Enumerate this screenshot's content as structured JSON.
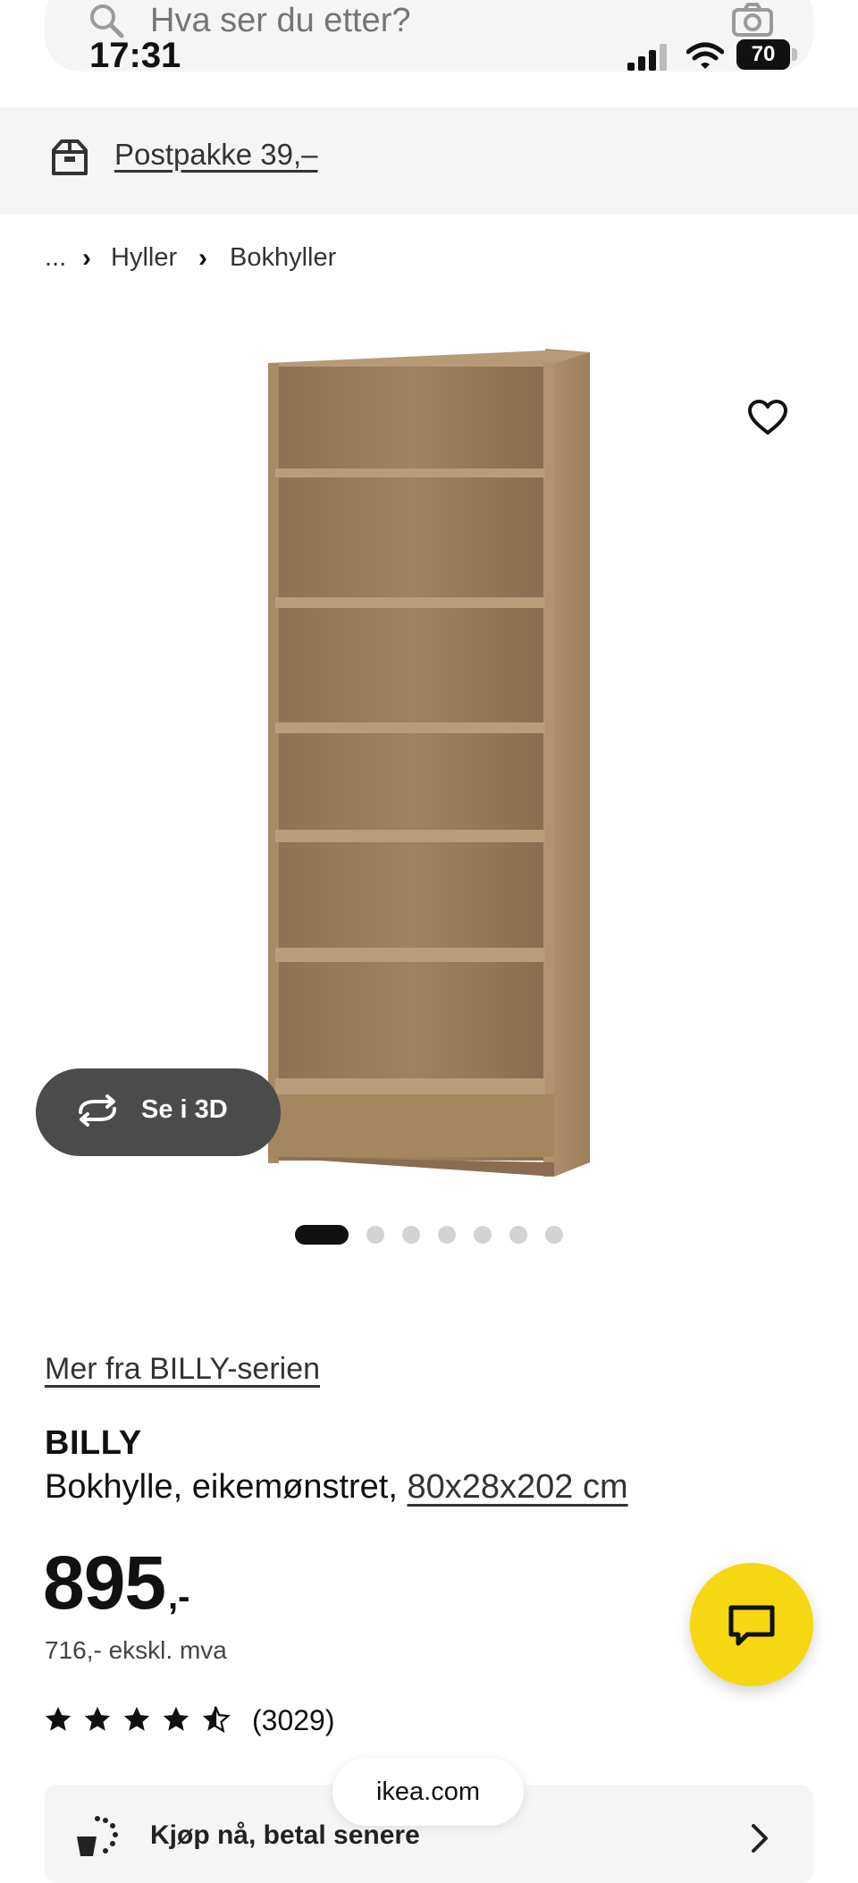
{
  "search": {
    "placeholder": "Hva ser du etter?"
  },
  "status_bar": {
    "time": "17:31",
    "battery": "70"
  },
  "banner": {
    "text": "Postpakke 39,–"
  },
  "breadcrumb": {
    "items": [
      "...",
      "Hyller",
      "Bokhyller"
    ]
  },
  "gallery": {
    "see_3d_label": "Se i 3D",
    "dots_total": 7,
    "active_index": 0
  },
  "product": {
    "series_link": "Mer fra BILLY-serien",
    "name": "BILLY",
    "description": "Bokhylle, eikemønstret,",
    "size": "80x28x202 cm",
    "price": "895",
    "price_suffix": ",-",
    "price_ex_vat": "716,- ekskl. mva",
    "rating": 4.5,
    "rating_count": "(3029)"
  },
  "pay_later": {
    "label": "Kjøp nå, betal senere"
  },
  "browser": {
    "url": "ikea.com"
  },
  "colors": {
    "chat_fab": "#f5d712",
    "see3d_bg": "#4b4b4b",
    "wood": "#a88a68"
  },
  "icons": [
    "search-icon",
    "camera-icon",
    "signal-icon",
    "wifi-icon",
    "box-icon",
    "heart-icon",
    "rotate-3d-icon",
    "star-icon",
    "chat-icon",
    "pay-later-icon",
    "chevron-right-icon"
  ]
}
